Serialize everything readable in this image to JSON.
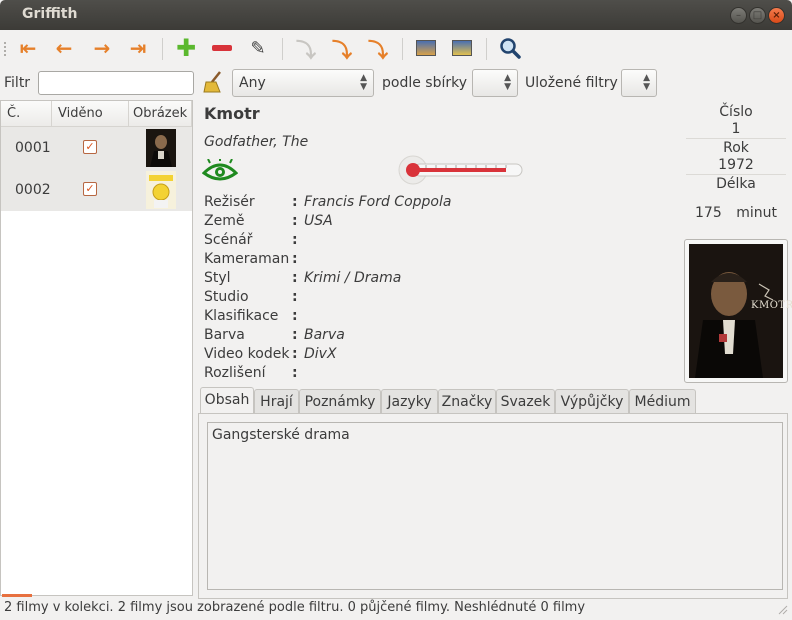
{
  "window": {
    "title": "Griffith"
  },
  "filter": {
    "label": "Filtr",
    "value": "",
    "any_option": "Any",
    "collection_label": "podle sbírky",
    "saved_filters_label": "Uložené filtry"
  },
  "list": {
    "columns": [
      "Č.",
      "Viděno",
      "Obrázek"
    ],
    "rows": [
      {
        "number": "0001",
        "seen": true
      },
      {
        "number": "0002",
        "seen": true
      }
    ]
  },
  "movie": {
    "title": "Kmotr",
    "original_title": "Godfather, The",
    "fields": [
      {
        "label": "Režisér",
        "value": "Francis Ford Coppola"
      },
      {
        "label": "Země",
        "value": "USA"
      },
      {
        "label": "Scénář",
        "value": ""
      },
      {
        "label": "Kameraman",
        "value": ""
      },
      {
        "label": "Styl",
        "value": "Krimi / Drama"
      },
      {
        "label": "Studio",
        "value": ""
      },
      {
        "label": "Klasifikace",
        "value": ""
      },
      {
        "label": "Barva",
        "value": "Barva"
      },
      {
        "label": "Video kodek",
        "value": "DivX"
      },
      {
        "label": "Rozlišení",
        "value": ""
      }
    ],
    "number_label": "Číslo",
    "number": "1",
    "year_label": "Rok",
    "year": "1972",
    "length_label": "Délka",
    "length": "175",
    "length_unit": "minut",
    "poster_text": "KMOTR",
    "rating_fraction": 0.9
  },
  "tabs": [
    "Obsah",
    "Hrají",
    "Poznámky",
    "Jazyky",
    "Značky",
    "Svazek",
    "Výpůjčky",
    "Médium"
  ],
  "plot": "Gangsterské drama",
  "status": "2 filmy v kolekci. 2 filmy jsou  zobrazené podle filtru. 0 půjčené filmy. Neshlédnuté 0 filmy",
  "colors": {
    "accent": "#e7703f",
    "seen_eye": "#1f8a1f"
  }
}
